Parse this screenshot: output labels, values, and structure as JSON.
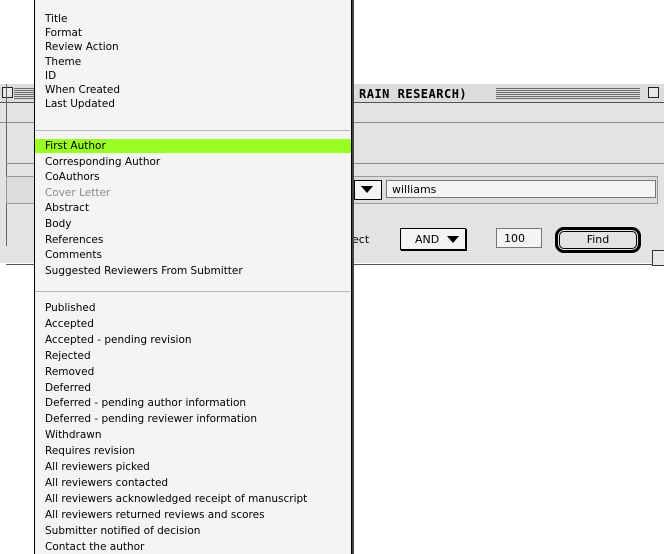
{
  "window": {
    "title_fragment": "RAIN RESEARCH)",
    "criteria_value": "williams",
    "select_label": "ect",
    "operator": "AND",
    "limit": "100",
    "find_label": "Find"
  },
  "menu": {
    "group1": [
      "Title",
      "Format",
      "Review Action",
      "Theme",
      "ID",
      "When Created",
      "Last Updated"
    ],
    "group2": [
      {
        "label": "First Author",
        "state": "selected"
      },
      {
        "label": "Corresponding Author",
        "state": "enabled"
      },
      {
        "label": "CoAuthors",
        "state": "enabled"
      },
      {
        "label": "Cover Letter",
        "state": "disabled"
      },
      {
        "label": "Abstract",
        "state": "enabled"
      },
      {
        "label": "Body",
        "state": "enabled"
      },
      {
        "label": "References",
        "state": "enabled"
      },
      {
        "label": "Comments",
        "state": "enabled"
      },
      {
        "label": "Suggested Reviewers From Submitter",
        "state": "enabled"
      }
    ],
    "group3": [
      "Published",
      "Accepted",
      "Accepted - pending revision",
      "Rejected",
      "Removed",
      "Deferred",
      "Deferred - pending author information",
      "Deferred - pending reviewer information",
      "Withdrawn",
      "Requires revision",
      "All reviewers picked",
      "All reviewers contacted",
      "All reviewers acknowledged receipt of manuscript",
      "All reviewers returned reviews and scores",
      "Submitter notified of decision",
      "Contact the author"
    ]
  },
  "colors": {
    "highlight": "#99ff22",
    "menu_bg": "#f4f4f4",
    "window_bg": "#e3e3e3",
    "disabled_text": "#8a8a8a"
  }
}
